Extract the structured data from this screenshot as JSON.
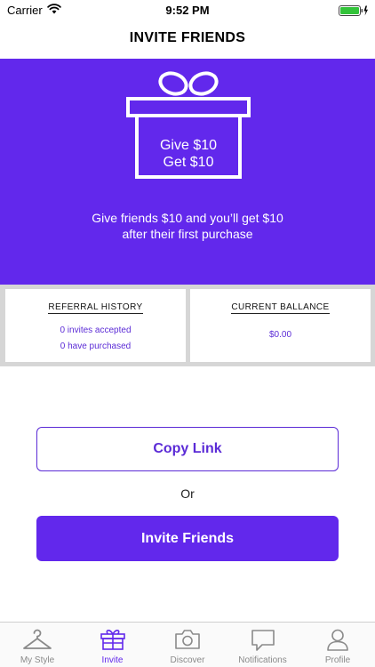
{
  "status_bar": {
    "carrier": "Carrier",
    "time": "9:52 PM"
  },
  "header": {
    "title": "INVITE FRIENDS"
  },
  "hero": {
    "background_color": "#6228ec",
    "gift_line_1": "Give $10",
    "gift_line_2": "Get $10",
    "description_line_1": "Give friends $10 and you’ll get $10",
    "description_line_2": "after their first purchase"
  },
  "referral_history": {
    "title": "REFERRAL HISTORY",
    "invites_accepted": "0 invites accepted",
    "purchased": "0 have purchased"
  },
  "current_balance": {
    "title": "CURRENT BALLANCE",
    "amount": "$0.00"
  },
  "actions": {
    "copy_link_label": "Copy Link",
    "or_label": "Or",
    "invite_friends_label": "Invite Friends"
  },
  "tab_bar": {
    "active_color": "#6228ec",
    "tabs": [
      {
        "label": "My Style",
        "icon": "hanger-icon"
      },
      {
        "label": "Invite",
        "icon": "gift-icon"
      },
      {
        "label": "Discover",
        "icon": "camera-icon"
      },
      {
        "label": "Notifications",
        "icon": "speech-bubble-icon"
      },
      {
        "label": "Profile",
        "icon": "person-icon"
      }
    ],
    "active_tab": "Invite"
  }
}
